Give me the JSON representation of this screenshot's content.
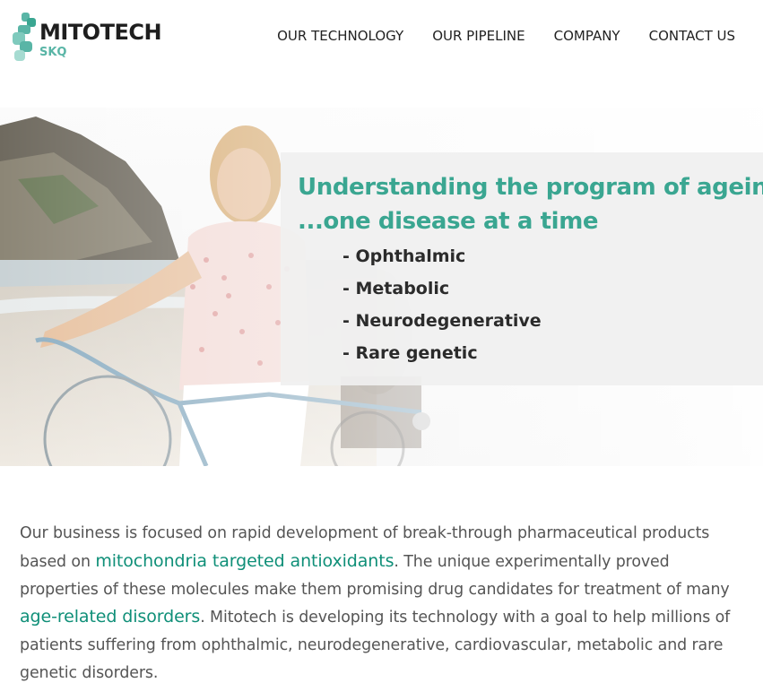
{
  "brand": {
    "name": "MITOTECH",
    "sub": "SKQ",
    "colors": {
      "teal": "#59b5a6",
      "dark": "#1e1e1e"
    }
  },
  "nav": {
    "items": [
      {
        "label": "OUR TECHNOLOGY"
      },
      {
        "label": "OUR PIPELINE"
      },
      {
        "label": "COMPANY"
      },
      {
        "label": "CONTACT US"
      }
    ]
  },
  "hero": {
    "title_line1": "Understanding the program of ageing",
    "title_line2": "...one disease at a time",
    "list": [
      "- Ophthalmic",
      "- Metabolic",
      "- Neurodegenerative",
      "- Rare genetic"
    ],
    "colors": {
      "title": "#3aa691"
    }
  },
  "intro": {
    "part1": "Our business is focused on rapid development of break-through pharmaceutical products based on ",
    "link1": "mitochondria targeted antioxidants",
    "part2": ". The unique experimentally proved properties of these molecules make them promising drug candidates for treatment of many ",
    "link2": "age-related disorders",
    "part3": ". Mitotech is developing its technology with a goal to help millions of patients suffering from ophthalmic, neurodegenerative, cardiovascular, metabolic and rare genetic disorders.",
    "colors": {
      "link": "#0f8f78",
      "text": "#555555"
    }
  }
}
